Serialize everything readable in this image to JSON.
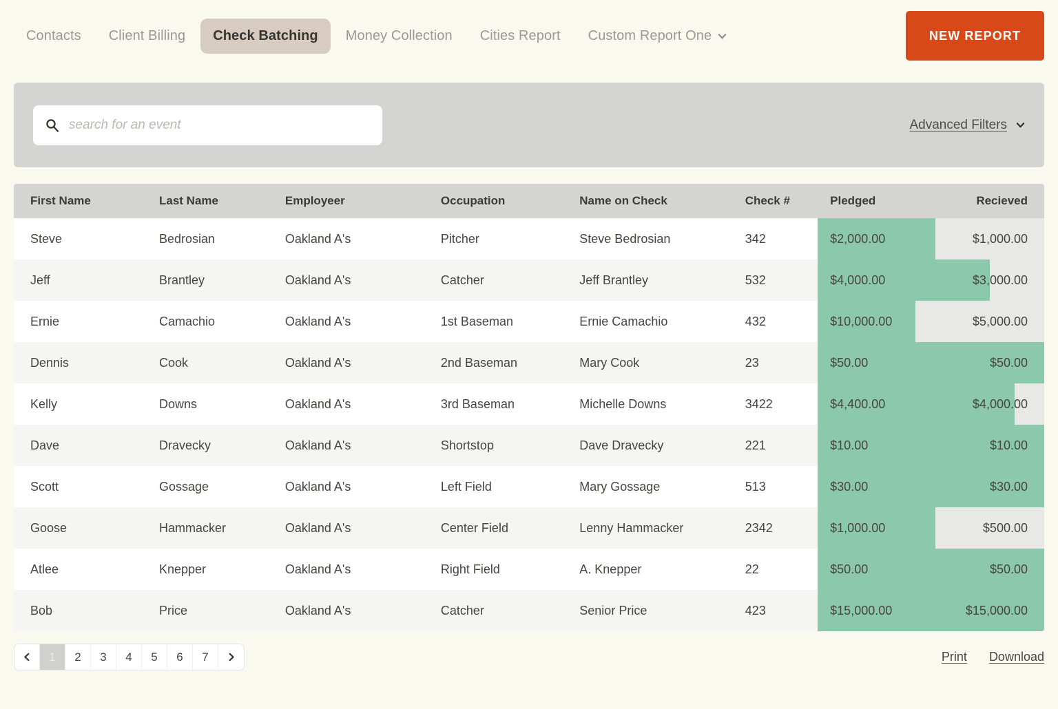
{
  "theme": {
    "page_bg": "#faf9f0",
    "accent_orange": "#d8491a",
    "active_tab_bg": "#d8ccc0",
    "filter_bar_bg": "#d4d4d2",
    "bar_green": "#8cc8ac",
    "bar_track": "#e8e8e6"
  },
  "nav": {
    "tabs": [
      {
        "label": "Contacts",
        "active": false,
        "has_caret": false
      },
      {
        "label": "Client Billing",
        "active": false,
        "has_caret": false
      },
      {
        "label": "Check Batching",
        "active": true,
        "has_caret": false
      },
      {
        "label": "Money Collection",
        "active": false,
        "has_caret": false
      },
      {
        "label": "Cities Report",
        "active": false,
        "has_caret": false
      },
      {
        "label": "Custom Report One",
        "active": false,
        "has_caret": true
      }
    ],
    "new_report_label": "NEW REPORT"
  },
  "filters": {
    "search_value": "",
    "search_placeholder": "search for an event",
    "advanced_filters_label": "Advanced Filters"
  },
  "table": {
    "columns": [
      "First Name",
      "Last Name",
      "Employeer",
      "Occupation",
      "Name on Check",
      "Check #",
      "Pledged",
      "Recieved"
    ],
    "rows": [
      {
        "first_name": "Steve",
        "last_name": "Bedrosian",
        "employer": "Oakland A's",
        "occupation": "Pitcher",
        "name_on_check": "Steve Bedrosian",
        "check_number": "342",
        "pledged": "$2,000.00",
        "recieved": "$1,000.00",
        "pledged_value": 2000,
        "recieved_value": 1000,
        "fill_percent": 52
      },
      {
        "first_name": "Jeff",
        "last_name": "Brantley",
        "employer": "Oakland A's",
        "occupation": "Catcher",
        "name_on_check": "Jeff Brantley",
        "check_number": "532",
        "pledged": "$4,000.00",
        "recieved": "$3,000.00",
        "pledged_value": 4000,
        "recieved_value": 3000,
        "fill_percent": 76
      },
      {
        "first_name": "Ernie",
        "last_name": "Camachio",
        "employer": "Oakland A's",
        "occupation": "1st Baseman",
        "name_on_check": "Ernie Camachio",
        "check_number": "432",
        "pledged": "$10,000.00",
        "recieved": "$5,000.00",
        "pledged_value": 10000,
        "recieved_value": 5000,
        "fill_percent": 43
      },
      {
        "first_name": "Dennis",
        "last_name": "Cook",
        "employer": "Oakland A's",
        "occupation": "2nd Baseman",
        "name_on_check": "Mary Cook",
        "check_number": "23",
        "pledged": "$50.00",
        "recieved": "$50.00",
        "pledged_value": 50,
        "recieved_value": 50,
        "fill_percent": 100
      },
      {
        "first_name": "Kelly",
        "last_name": "Downs",
        "employer": "Oakland A's",
        "occupation": "3rd Baseman",
        "name_on_check": "Michelle Downs",
        "check_number": "3422",
        "pledged": "$4,400.00",
        "recieved": "$4,000.00",
        "pledged_value": 4400,
        "recieved_value": 4000,
        "fill_percent": 87
      },
      {
        "first_name": "Dave",
        "last_name": "Dravecky",
        "employer": "Oakland A's",
        "occupation": "Shortstop",
        "name_on_check": "Dave Dravecky",
        "check_number": "221",
        "pledged": "$10.00",
        "recieved": "$10.00",
        "pledged_value": 10,
        "recieved_value": 10,
        "fill_percent": 100
      },
      {
        "first_name": "Scott",
        "last_name": "Gossage",
        "employer": "Oakland A's",
        "occupation": "Left Field",
        "name_on_check": "Mary Gossage",
        "check_number": "513",
        "pledged": "$30.00",
        "recieved": "$30.00",
        "pledged_value": 30,
        "recieved_value": 30,
        "fill_percent": 100
      },
      {
        "first_name": "Goose",
        "last_name": "Hammacker",
        "employer": "Oakland A's",
        "occupation": "Center Field",
        "name_on_check": "Lenny Hammacker",
        "check_number": "2342",
        "pledged": "$1,000.00",
        "recieved": "$500.00",
        "pledged_value": 1000,
        "recieved_value": 500,
        "fill_percent": 52
      },
      {
        "first_name": "Atlee",
        "last_name": "Knepper",
        "employer": "Oakland A's",
        "occupation": "Right Field",
        "name_on_check": "A. Knepper",
        "check_number": "22",
        "pledged": "$50.00",
        "recieved": "$50.00",
        "pledged_value": 50,
        "recieved_value": 50,
        "fill_percent": 100
      },
      {
        "first_name": "Bob",
        "last_name": "Price",
        "employer": "Oakland A's",
        "occupation": "Catcher",
        "name_on_check": "Senior Price",
        "check_number": "423",
        "pledged": "$15,000.00",
        "recieved": "$15,000.00",
        "pledged_value": 15000,
        "recieved_value": 15000,
        "fill_percent": 100
      }
    ]
  },
  "footer": {
    "pages": [
      "1",
      "2",
      "3",
      "4",
      "5",
      "6",
      "7"
    ],
    "current_page": "1",
    "prev_icon": "chevron-left-icon",
    "next_icon": "chevron-right-icon",
    "print_label": "Print",
    "download_label": "Download"
  }
}
